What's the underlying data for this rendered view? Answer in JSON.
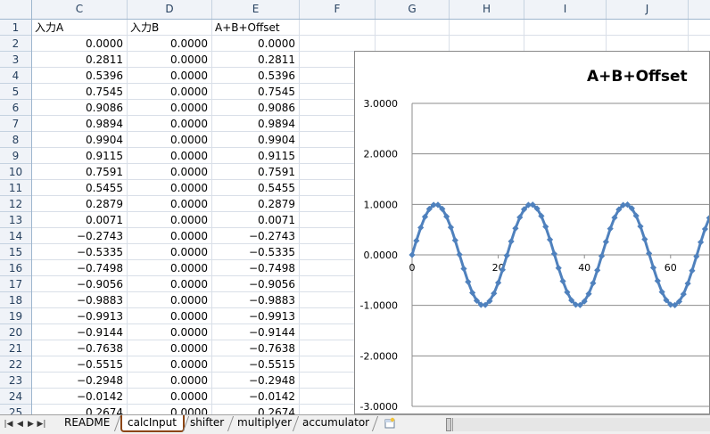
{
  "columns": [
    "C",
    "D",
    "E",
    "F",
    "G",
    "H",
    "I",
    "J"
  ],
  "rows": [
    "1",
    "2",
    "3",
    "4",
    "5",
    "6",
    "7",
    "8",
    "9",
    "10",
    "11",
    "12",
    "13",
    "14",
    "15",
    "16",
    "17",
    "18",
    "19",
    "20",
    "21",
    "22",
    "23",
    "24",
    "25"
  ],
  "header_row": {
    "a": "入力A",
    "b": "入力B",
    "sum": "A+B+Offset"
  },
  "data": [
    [
      "0.0000",
      "0.0000",
      "0.0000"
    ],
    [
      "0.2811",
      "0.0000",
      "0.2811"
    ],
    [
      "0.5396",
      "0.0000",
      "0.5396"
    ],
    [
      "0.7545",
      "0.0000",
      "0.7545"
    ],
    [
      "0.9086",
      "0.0000",
      "0.9086"
    ],
    [
      "0.9894",
      "0.0000",
      "0.9894"
    ],
    [
      "0.9904",
      "0.0000",
      "0.9904"
    ],
    [
      "0.9115",
      "0.0000",
      "0.9115"
    ],
    [
      "0.7591",
      "0.0000",
      "0.7591"
    ],
    [
      "0.5455",
      "0.0000",
      "0.5455"
    ],
    [
      "0.2879",
      "0.0000",
      "0.2879"
    ],
    [
      "0.0071",
      "0.0000",
      "0.0071"
    ],
    [
      "−0.2743",
      "0.0000",
      "−0.2743"
    ],
    [
      "−0.5335",
      "0.0000",
      "−0.5335"
    ],
    [
      "−0.7498",
      "0.0000",
      "−0.7498"
    ],
    [
      "−0.9056",
      "0.0000",
      "−0.9056"
    ],
    [
      "−0.9883",
      "0.0000",
      "−0.9883"
    ],
    [
      "−0.9913",
      "0.0000",
      "−0.9913"
    ],
    [
      "−0.9144",
      "0.0000",
      "−0.9144"
    ],
    [
      "−0.7638",
      "0.0000",
      "−0.7638"
    ],
    [
      "−0.5515",
      "0.0000",
      "−0.5515"
    ],
    [
      "−0.2948",
      "0.0000",
      "−0.2948"
    ],
    [
      "−0.0142",
      "0.0000",
      "−0.0142"
    ],
    [
      "0.2674",
      "0.0000",
      "0.2674"
    ]
  ],
  "chart_data": {
    "type": "line",
    "title": "A+B+Offset",
    "xlabel": "",
    "ylabel": "",
    "ylim": [
      -3,
      3
    ],
    "yticks": [
      "3.0000",
      "2.0000",
      "1.0000",
      "0.0000",
      "-1.0000",
      "-2.0000",
      "-3.0000"
    ],
    "xticks": [
      "0",
      "20",
      "40",
      "60"
    ],
    "series": [
      {
        "values": [
          0.0,
          0.2811,
          0.5396,
          0.7545,
          0.9086,
          0.9894,
          0.9904,
          0.9115,
          0.7591,
          0.5455,
          0.2879,
          0.0071,
          -0.2743,
          -0.5335,
          -0.7498,
          -0.9056,
          -0.9883,
          -0.9913,
          -0.9144,
          -0.7638,
          -0.5515,
          -0.2948,
          -0.0142,
          0.2674,
          0.5256,
          0.7433,
          0.9023,
          0.9876,
          0.9928,
          0.9182,
          0.7697,
          0.5577,
          0.3018,
          0.0213,
          -0.2607,
          -0.5201,
          -0.7391,
          -0.8997,
          -0.9868,
          -0.9935,
          -0.9201,
          -0.7719,
          -0.5606,
          -0.3047,
          -0.0244,
          0.2579,
          0.5179,
          0.7375,
          0.8985,
          0.9862,
          0.9943,
          0.9218,
          0.7751,
          0.564,
          0.3088,
          0.0284,
          -0.2542,
          -0.5142,
          -0.7345,
          -0.8968,
          -0.9859,
          -0.9948,
          -0.9239,
          -0.7779,
          -0.568,
          -0.3125,
          -0.0319,
          0.2506,
          0.511,
          0.732,
          0.8952,
          0.9853,
          0.9951,
          0.9252,
          0.7799
        ],
        "color": "#4f81bd"
      }
    ],
    "grid": "horizontal",
    "legend": "none"
  },
  "tabs": [
    "README",
    "calcInput",
    "shifter",
    "multiplyer",
    "accumulator"
  ],
  "active_tab": "calcInput",
  "icons": {
    "nav_first": "first-sheet-icon",
    "nav_prev": "prev-sheet-icon",
    "nav_next": "next-sheet-icon",
    "nav_last": "last-sheet-icon",
    "insert": "insert-sheet-icon"
  }
}
